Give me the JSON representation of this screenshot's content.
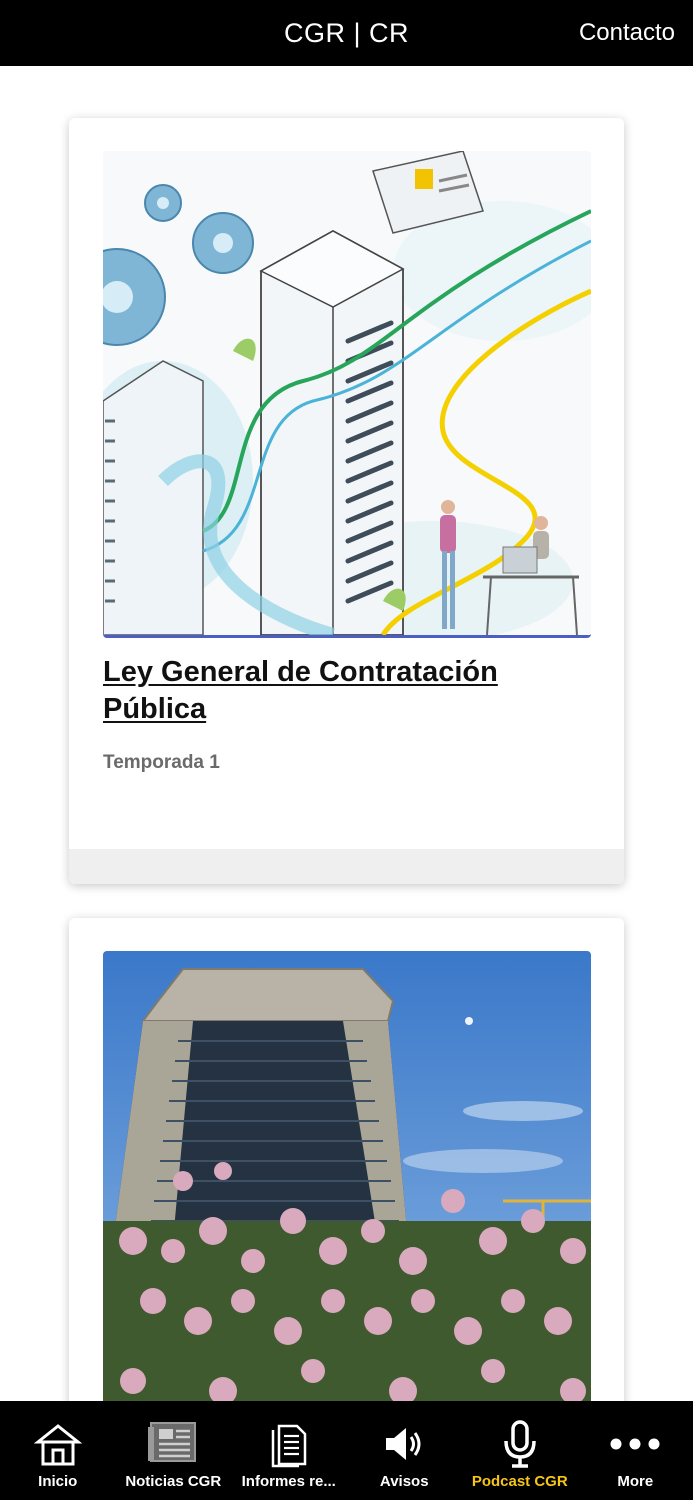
{
  "header": {
    "title": "CGR | CR",
    "contact_label": "Contacto"
  },
  "cards": [
    {
      "title": "Ley General de Contratación Pública",
      "subtitle": "Temporada 1"
    },
    {
      "title": "",
      "subtitle": ""
    }
  ],
  "tabbar": {
    "items": [
      {
        "label": "Inicio",
        "icon": "home-icon"
      },
      {
        "label": "Noticias CGR",
        "icon": "newspaper-icon"
      },
      {
        "label": "Informes re...",
        "icon": "documents-icon"
      },
      {
        "label": "Avisos",
        "icon": "speaker-icon"
      },
      {
        "label": "Podcast CGR",
        "icon": "microphone-icon",
        "active": true
      },
      {
        "label": "More",
        "icon": "more-icon"
      }
    ],
    "active_color": "#f5c518"
  }
}
